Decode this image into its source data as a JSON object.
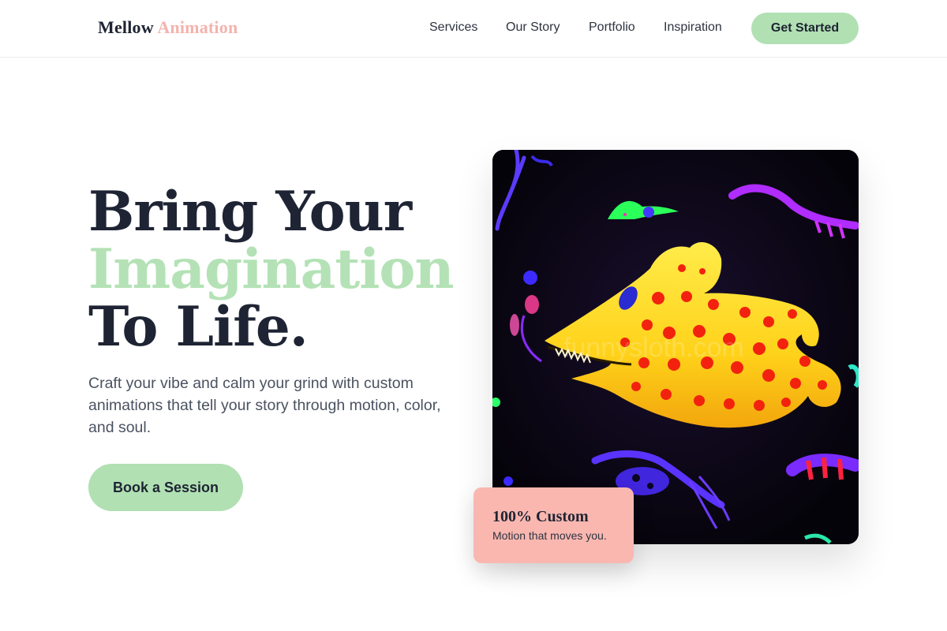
{
  "brand": {
    "name": "Mellow",
    "accent": "Animation"
  },
  "nav": {
    "links": [
      "Services",
      "Our Story",
      "Portfolio",
      "Inspiration"
    ],
    "cta": "Get Started"
  },
  "hero": {
    "headline_line1": "Bring Your",
    "headline_line2": "Imagination",
    "headline_line3": "To Life.",
    "subtext": "Craft your vibe and calm your grind with custom animations that tell your story through motion, color, and soul.",
    "cta": "Book a Session",
    "image_watermark": "funnysloth.com"
  },
  "badge": {
    "title": "100% Custom",
    "subtitle": "Motion that moves you."
  },
  "colors": {
    "primary_green": "#b1e0b3",
    "accent_pink": "#f4b3ad",
    "badge_pink": "#f9b7b0",
    "dark_text": "#1e2433"
  }
}
